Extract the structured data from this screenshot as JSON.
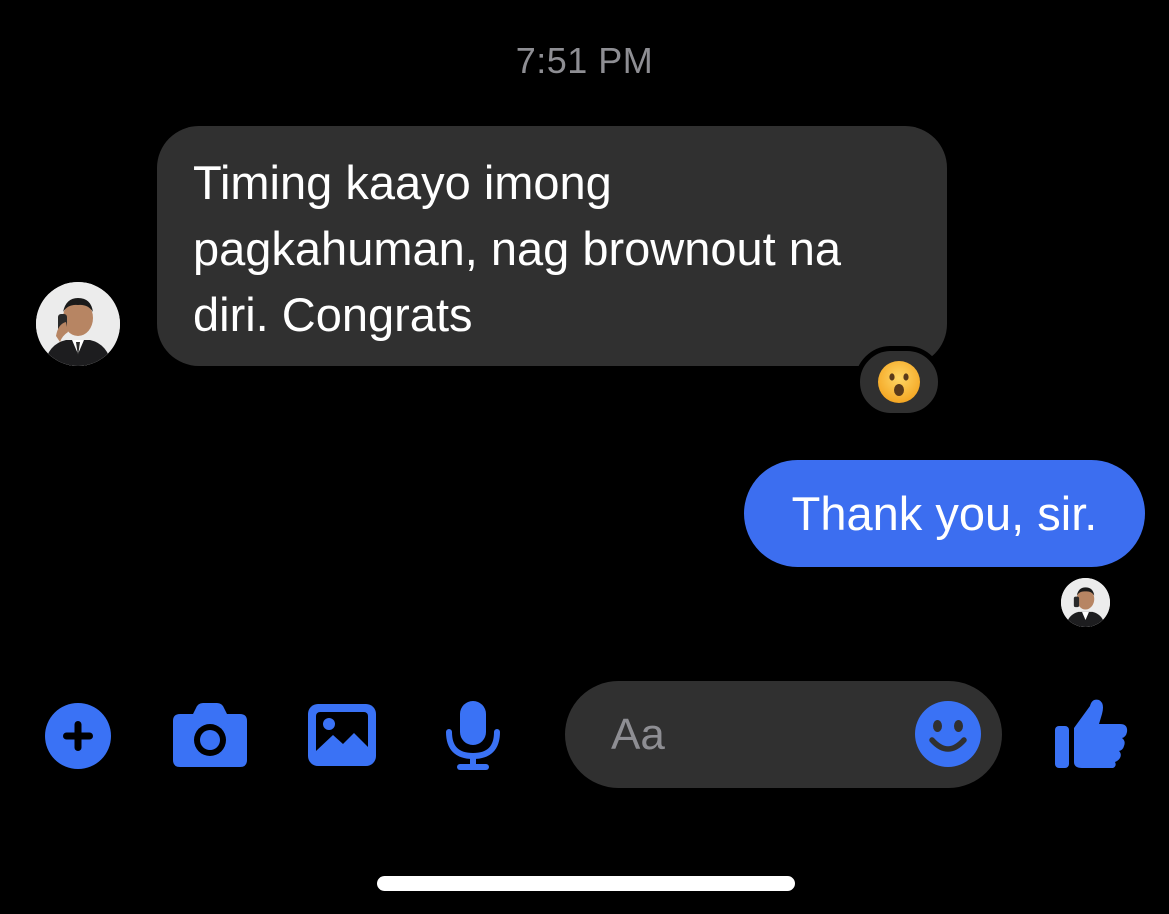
{
  "conversation": {
    "timestamp": "7:51 PM",
    "messages": [
      {
        "direction": "incoming",
        "text": "Timing kaayo imong\npagkahuman, nag brownout na\ndiri. Congrats",
        "reaction": "😮"
      },
      {
        "direction": "outgoing",
        "text": "Thank you, sir."
      }
    ]
  },
  "composer": {
    "placeholder": "Aa",
    "buttons": [
      "plus-icon",
      "camera-icon",
      "gallery-icon",
      "microphone-icon",
      "emoji-icon",
      "thumbs-up-icon"
    ]
  },
  "theme": {
    "background": "#000000",
    "incoming_bubble": "#303030",
    "outgoing_bubble": "#3c6ef0",
    "accent": "#3a72f5",
    "muted_text": "#8e8e93"
  }
}
